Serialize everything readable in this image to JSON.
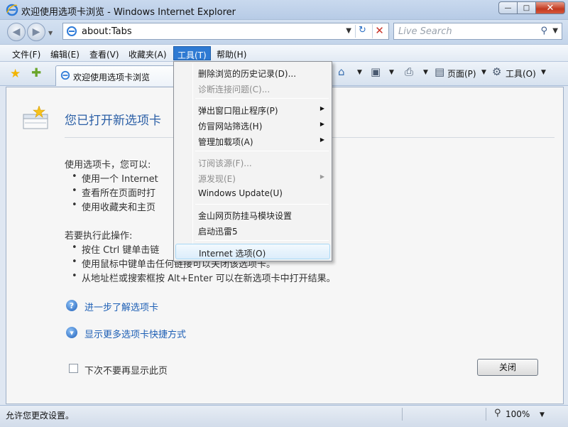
{
  "window": {
    "title": "欢迎使用选项卡浏览 - Windows Internet Explorer",
    "minimize_glyph": "—",
    "maximize_glyph": "□",
    "close_glyph": "✕"
  },
  "address": {
    "url": "about:Tabs",
    "back_glyph": "◀",
    "forward_glyph": "▶",
    "refresh_glyph": "↻",
    "stop_glyph": "✕"
  },
  "search": {
    "placeholder": "Live Search",
    "icon_glyph": "⚲"
  },
  "menu": {
    "file": "文件(F)",
    "edit": "编辑(E)",
    "view": "查看(V)",
    "favorites": "收藏夹(A)",
    "tools": "工具(T)",
    "help": "帮助(H)"
  },
  "tab": {
    "label": "欢迎使用选项卡浏览"
  },
  "commands": {
    "page": "页面(P)",
    "tools": "工具(O)"
  },
  "tools_menu": {
    "delete_history": "删除浏览的历史记录(D)...",
    "diagnose": "诊断连接问题(C)...",
    "popup_blocker": "弹出窗口阻止程序(P)",
    "phishing_filter": "仿冒网站筛选(H)",
    "manage_addons": "管理加载项(A)",
    "subscribe_feed": "订阅该源(F)...",
    "feed_discovery": "源发现(E)",
    "windows_update": "Windows Update(U)",
    "kingsoft": "金山网页防挂马模块设置",
    "thunder": "启动迅雷5",
    "internet_options": "Internet 选项(O)"
  },
  "content": {
    "heading": "您已打开新选项卡",
    "intro": "使用选项卡，您可以:",
    "bullets1": [
      "使用一个 Internet",
      "查看所在页面时打",
      "使用收藏夹和主页"
    ],
    "intro2": "若要执行此操作:",
    "bullets2": [
      "按住 Ctrl 键单击链",
      "使用鼠标中键单击任何链接可以关闭该选项卡。",
      "从地址栏或搜索框按 Alt+Enter 可以在新选项卡中打开结果。"
    ],
    "link_learn": "进一步了解选项卡",
    "link_shortcuts": "显示更多选项卡快捷方式",
    "dont_show": "下次不要再显示此页",
    "close_button": "关闭"
  },
  "status": {
    "text": "允许您更改设置。",
    "zoom": "100%"
  },
  "colors": {
    "menu_highlight": "#2e7ad3",
    "link": "#1d5fb5",
    "heading": "#2b5fa6"
  }
}
